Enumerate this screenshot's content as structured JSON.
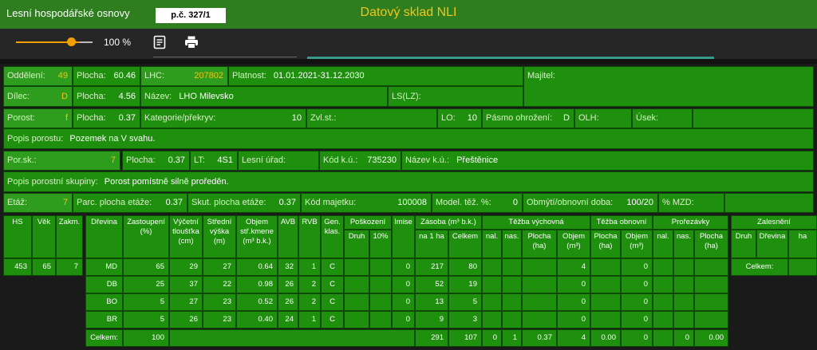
{
  "header": {
    "title": "Lesní hospodářské osnovy",
    "pc": "p.č. 327/1",
    "app_title": "Datový sklad NLI"
  },
  "toolbar": {
    "zoom": "100 %",
    "zoom_level": 0.85
  },
  "rows": {
    "oddeleni_label": "Oddělení:",
    "oddeleni": "49",
    "plocha1_label": "Plocha:",
    "plocha1": "60.46",
    "lhc_label": "LHC:",
    "lhc": "207802",
    "platnost_label": "Platnost:",
    "platnost": "01.01.2021-31.12.2030",
    "majitel_label": "Majitel:",
    "dilec_label": "Dílec:",
    "dilec": "D",
    "plocha2_label": "Plocha:",
    "plocha2": "4.56",
    "nazev_label": "Název:",
    "nazev": "LHO Milevsko",
    "ls_label": "LS(LZ):",
    "porost_label": "Porost:",
    "porost": "f",
    "plocha3_label": "Plocha:",
    "plocha3": "0.37",
    "kategorie_label": "Kategorie/překryv:",
    "kategorie": "10",
    "zvl_label": "Zvl.st.:",
    "lo_label": "LO:",
    "lo": "10",
    "pasmo_label": "Pásmo ohrožení:",
    "pasmo": "D",
    "olh_label": "OLH:",
    "usek_label": "Úsek:",
    "popis_porostu_label": "Popis porostu:",
    "popis_porostu": "Pozemek na V svahu.",
    "porsk_label": "Por.sk.:",
    "porsk": "7",
    "plocha4_label": "Plocha:",
    "plocha4": "0.37",
    "lt_label": "LT:",
    "lt": "4S1",
    "lesni_urad_label": "Lesní úřad:",
    "kod_ku_label": "Kód k.ú.:",
    "kod_ku": "735230",
    "nazev_ku_label": "Název k.ú.:",
    "nazev_ku": "Přeštěnice",
    "popis_skupiny_label": "Popis porostní skupiny:",
    "popis_skupiny": "Porost pomístně silně proředěn.",
    "etaz_label": "Etáž:",
    "etaz": "7",
    "parc_label": "Parc. plocha etáže:",
    "parc": "0.37",
    "skut_label": "Skut. plocha etáže:",
    "skut": "0.37",
    "kod_majetku_label": "Kód majetku:",
    "kod_majetku": "100008",
    "model_label": "Model. těž. %:",
    "model": "0",
    "obmyti_label": "Obmýtí/obnovní doba:",
    "obmyti": "100/20",
    "mzd_label": "% MZD:"
  },
  "left_table": {
    "headers": [
      "HS",
      "Věk",
      "Zakm."
    ],
    "values": [
      "453",
      "65",
      "7"
    ]
  },
  "main_table": {
    "h_drevina": "Dřevina",
    "h_zastoupeni": "Zastoupení (%)",
    "h_vycetni": "Výčetní tloušťka (cm)",
    "h_stredni": "Střední výška (m)",
    "h_objem": "Objem stř.kmene (m³ b.k.)",
    "h_avb": "AVB",
    "h_rvb": "RVB",
    "h_gen": "Gen. klas.",
    "h_poskozeni": "Poškození",
    "h_druh": "Druh",
    "h_10": "10%",
    "h_imise": "Imise",
    "h_zasoba": "Zásoba (m³ b.k.)",
    "h_na1ha": "na 1 ha",
    "h_celkem": "Celkem",
    "h_tezba_vych": "Těžba výchovná",
    "h_nal": "nal.",
    "h_nas": "nas.",
    "h_plocha_ha": "Plocha (ha)",
    "h_objem_m3": "Objem (m³)",
    "h_tezba_obn": "Těžba obnovní",
    "h_prorezavky": "Prořezávky",
    "rows": [
      {
        "d": "MD",
        "z": "65",
        "v": "29",
        "s": "27",
        "o": "0.64",
        "avb": "32",
        "rvb": "1",
        "g": "C",
        "imise": "0",
        "na1ha": "217",
        "celkem": "80",
        "tv_objem": "4",
        "to_objem": "0"
      },
      {
        "d": "DB",
        "z": "25",
        "v": "37",
        "s": "22",
        "o": "0.98",
        "avb": "26",
        "rvb": "2",
        "g": "C",
        "imise": "0",
        "na1ha": "52",
        "celkem": "19",
        "tv_objem": "0",
        "to_objem": "0"
      },
      {
        "d": "BO",
        "z": "5",
        "v": "27",
        "s": "23",
        "o": "0.52",
        "avb": "26",
        "rvb": "2",
        "g": "C",
        "imise": "0",
        "na1ha": "13",
        "celkem": "5",
        "tv_objem": "0",
        "to_objem": "0"
      },
      {
        "d": "BR",
        "z": "5",
        "v": "26",
        "s": "23",
        "o": "0.40",
        "avb": "24",
        "rvb": "1",
        "g": "C",
        "imise": "0",
        "na1ha": "9",
        "celkem": "3",
        "tv_objem": "0",
        "to_objem": "0"
      }
    ],
    "total": {
      "label": "Celkem:",
      "z": "100",
      "na1ha": "291",
      "celkem": "107",
      "tv_nal": "0",
      "tv_nas": "1",
      "tv_plocha": "0.37",
      "tv_objem": "4",
      "to_plocha": "0.00",
      "to_objem": "0",
      "pr_plocha": "0",
      "pr_last": "0.00"
    }
  },
  "right_table": {
    "h_zalesneni": "Zalesnění",
    "h_druh": "Druh",
    "h_drevina": "Dřevina",
    "h_ha": "ha",
    "celkem": "Celkem:"
  }
}
